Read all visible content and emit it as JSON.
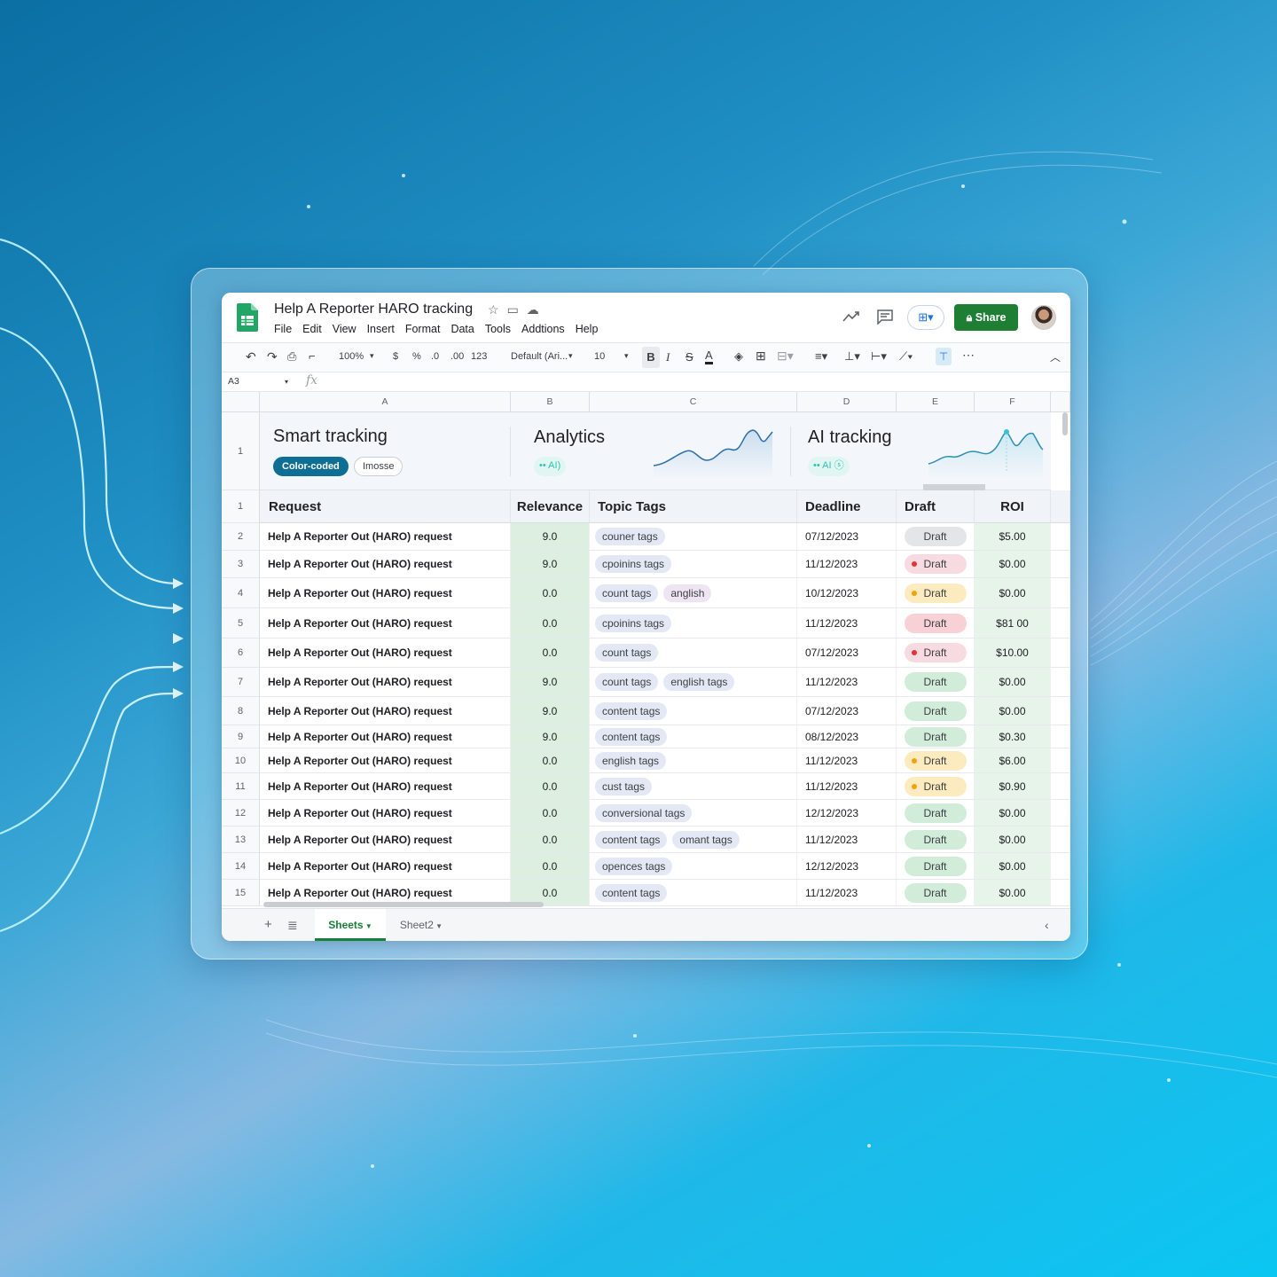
{
  "doc": {
    "title": "Help A Reporter HARO tracking"
  },
  "menu": [
    "File",
    "Edit",
    "View",
    "Insert",
    "Format",
    "Data",
    "Tools",
    "Addtions",
    "Help"
  ],
  "header_right": {
    "share_label": "Share"
  },
  "toolbar": {
    "zoom": "100%",
    "currency": "$",
    "percent": "%",
    "dec_less": ".0",
    "dec_more": ".00",
    "format_more": "123",
    "font": "Default (Ari...",
    "font_size": "10",
    "bold": "B",
    "italic": "I",
    "strike": "S",
    "text_color": "A"
  },
  "formula": {
    "name_box": "A3",
    "fx": "fx"
  },
  "columns": [
    "A",
    "B",
    "C",
    "D",
    "E",
    "F"
  ],
  "banner": {
    "row_number": "1",
    "smart_title": "Smart tracking",
    "chip_color": "Color-coded",
    "chip_imosse": "Imosse",
    "analytics_title": "Analytics",
    "analytics_badge": "AI",
    "ai_title": "AI tracking",
    "ai_badge": "AI"
  },
  "table": {
    "header_row_number": "1",
    "headers": [
      "Request",
      "Relevance",
      "Topic Tags",
      "Deadline",
      "Draft",
      "ROI"
    ],
    "rows": [
      {
        "n": "2",
        "request": "Help A Reporter Out (HARO) request",
        "rel": "9.0",
        "tags": [
          "couner tags"
        ],
        "deadline": "07/12/2023",
        "draft": "Draft",
        "status": "gray",
        "roi": "$5.00"
      },
      {
        "n": "3",
        "request": "Help A Reporter Out (HARO) request",
        "rel": "9.0",
        "tags": [
          "cpoinins tags"
        ],
        "deadline": "11/12/2023",
        "draft": "Draft",
        "status": "red",
        "roi": "$0.00"
      },
      {
        "n": "4",
        "request": "Help A Reporter Out (HARO) request",
        "rel": "0.0",
        "tags": [
          "count tags",
          "anglish"
        ],
        "deadline": "10/12/2023",
        "draft": "Draft",
        "status": "yellow",
        "roi": "$0.00"
      },
      {
        "n": "5",
        "request": "Help A Reporter Out (HARO) request",
        "rel": "0.0",
        "tags": [
          "cpoinins tags"
        ],
        "deadline": "11/12/2023",
        "draft": "Draft",
        "status": "pink",
        "roi": "$81 00"
      },
      {
        "n": "6",
        "request": "Help A Reporter Out (HARO) request",
        "rel": "0.0",
        "tags": [
          "count tags"
        ],
        "deadline": "07/12/2023",
        "draft": "Draft",
        "status": "red",
        "roi": "$10.00"
      },
      {
        "n": "7",
        "request": "Help A Reporter Out (HARO) request",
        "rel": "9.0",
        "tags": [
          "count tags",
          "english tags"
        ],
        "deadline": "11/12/2023",
        "draft": "Draft",
        "status": "green",
        "roi": "$0.00"
      },
      {
        "n": "8",
        "request": "Help A Reporter Out (HARO) request",
        "rel": "9.0",
        "tags": [
          "content tags"
        ],
        "deadline": "07/12/2023",
        "draft": "Draft",
        "status": "green",
        "roi": "$0.00"
      },
      {
        "n": "9",
        "request": "Help A Reporter Out (HARO) request",
        "rel": "9.0",
        "tags": [
          "content tags"
        ],
        "deadline": "08/12/2023",
        "draft": "Draft",
        "status": "green",
        "roi": "$0.30"
      },
      {
        "n": "10",
        "request": "Help A Reporter Out (HARO) request",
        "rel": "0.0",
        "tags": [
          "english tags"
        ],
        "deadline": "11/12/2023",
        "draft": "Draft",
        "status": "yellow",
        "roi": "$6.00"
      },
      {
        "n": "11",
        "request": "Help A Reporter Out (HARO) request",
        "rel": "0.0",
        "tags": [
          "cust tags"
        ],
        "deadline": "11/12/2023",
        "draft": "Draft",
        "status": "yellow",
        "roi": "$0.90"
      },
      {
        "n": "12",
        "request": "Help A Reporter Out (HARO) request",
        "rel": "0.0",
        "tags": [
          "conversional tags"
        ],
        "deadline": "12/12/2023",
        "draft": "Draft",
        "status": "green",
        "roi": "$0.00"
      },
      {
        "n": "13",
        "request": "Help A Reporter Out (HARO) request",
        "rel": "0.0",
        "tags": [
          "content tags",
          "omant tags"
        ],
        "deadline": "11/12/2023",
        "draft": "Draft",
        "status": "green",
        "roi": "$0.00"
      },
      {
        "n": "14",
        "request": "Help A Reporter Out (HARO) request",
        "rel": "0.0",
        "tags": [
          "opences tags"
        ],
        "deadline": "12/12/2023",
        "draft": "Draft",
        "status": "green",
        "roi": "$0.00"
      },
      {
        "n": "15",
        "request": "Help A Reporter Out (HARO) request",
        "rel": "0.0",
        "tags": [
          "content tags"
        ],
        "deadline": "11/12/2023",
        "draft": "Draft",
        "status": "green",
        "roi": "$0.00"
      }
    ]
  },
  "sheet_tabs": {
    "active": "Sheets",
    "other": "Sheet2"
  },
  "colors": {
    "share_green": "#1e7e34",
    "accent_blue": "#1a73e8",
    "relevance_bg": "#dcefe0",
    "roi_bg": "#e6f4ea"
  }
}
